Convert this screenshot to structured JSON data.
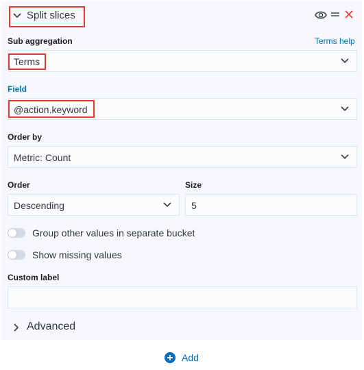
{
  "header": {
    "title": "Split slices"
  },
  "sub_aggregation": {
    "label": "Sub aggregation",
    "help_link": "Terms help",
    "value": "Terms"
  },
  "field": {
    "label": "Field",
    "value": "@action.keyword"
  },
  "order_by": {
    "label": "Order by",
    "value": "Metric: Count"
  },
  "order": {
    "label": "Order",
    "value": "Descending"
  },
  "size": {
    "label": "Size",
    "value": "5"
  },
  "toggles": {
    "group_other": "Group other values in separate bucket",
    "show_missing": "Show missing values"
  },
  "custom_label": {
    "label": "Custom label",
    "value": ""
  },
  "advanced": {
    "label": "Advanced"
  },
  "add": {
    "label": "Add"
  },
  "colors": {
    "accent": "#006bb8",
    "danger": "#e53935",
    "highlight": "#e53935"
  }
}
